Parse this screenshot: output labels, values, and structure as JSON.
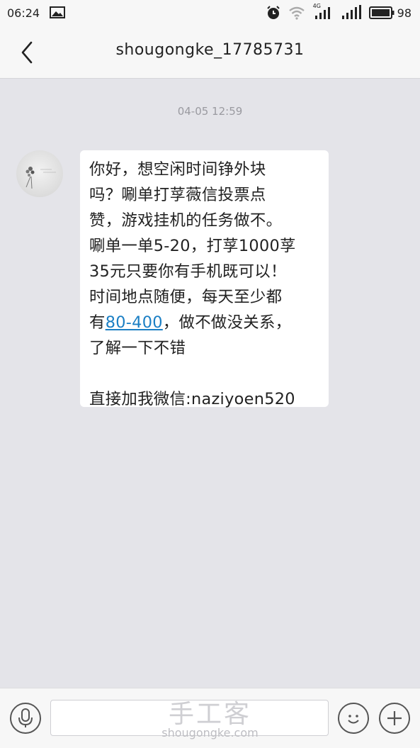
{
  "status_bar": {
    "time": "06:24",
    "network_label": "4G",
    "battery": "98"
  },
  "header": {
    "title": "shougongke_17785731"
  },
  "conversation": {
    "timestamp": "04-05 12:59",
    "message": {
      "lines": [
        " 你好，想空闲时间铮外块",
        "吗？唰单打莩薇信投票点",
        "赞，游戏挂机的任务做不。",
        "唰单一单5-20，打莩1000莩",
        "35元只要你有手机既可以！",
        "时间地点随便，每天至少都"
      ],
      "line7_prefix": "有",
      "line7_link": "80-400",
      "line7_suffix": "，做不做没关系，",
      "line8": "了解一下不错",
      "contact_line": "直接加我微信:naziyoen520"
    }
  },
  "input_bar": {
    "watermark_cn": "手工客",
    "watermark_en": "shougongke.com"
  },
  "colors": {
    "background": "#e4e4e9",
    "bubble": "#ffffff",
    "link": "#1b7fc4",
    "bar": "#f7f7f7"
  },
  "icons": [
    "gallery-icon",
    "alarm-icon",
    "wifi-icon",
    "signal-icon",
    "battery-icon",
    "back-arrow-icon",
    "microphone-icon",
    "emoji-icon",
    "plus-icon"
  ]
}
